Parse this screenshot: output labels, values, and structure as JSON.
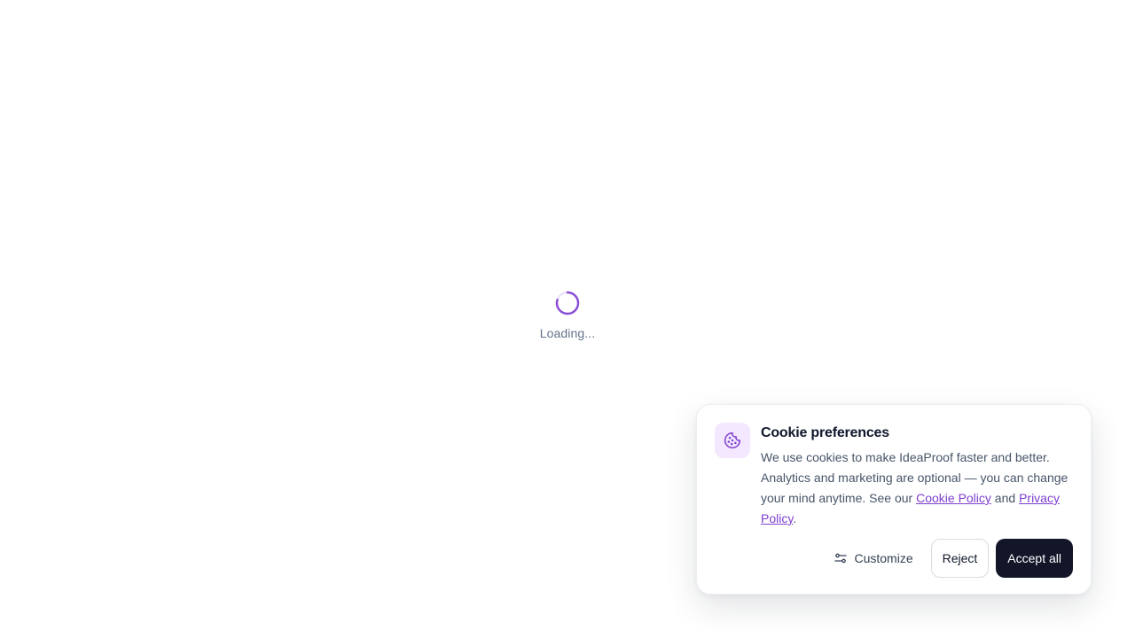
{
  "loading": {
    "text": "Loading...",
    "spinner_icon": "spinner-icon",
    "accent_color": "#8b4fd6"
  },
  "cookie_banner": {
    "icon": "cookie-icon",
    "title": "Cookie preferences",
    "body_text": "We use cookies to make IdeaProof faster and better. Analytics and marketing are optional — you can change your mind anytime. See our ",
    "cookie_policy_link": "Cookie Policy",
    "and_text": " and ",
    "privacy_policy_link": "Privacy Policy",
    "end_text": ".",
    "link_color": "#7e3fd0",
    "buttons": {
      "customize_icon": "sliders-icon",
      "customize_label": "Customize",
      "reject_label": "Reject",
      "accept_label": "Accept all"
    },
    "accept_color": "#121628"
  }
}
